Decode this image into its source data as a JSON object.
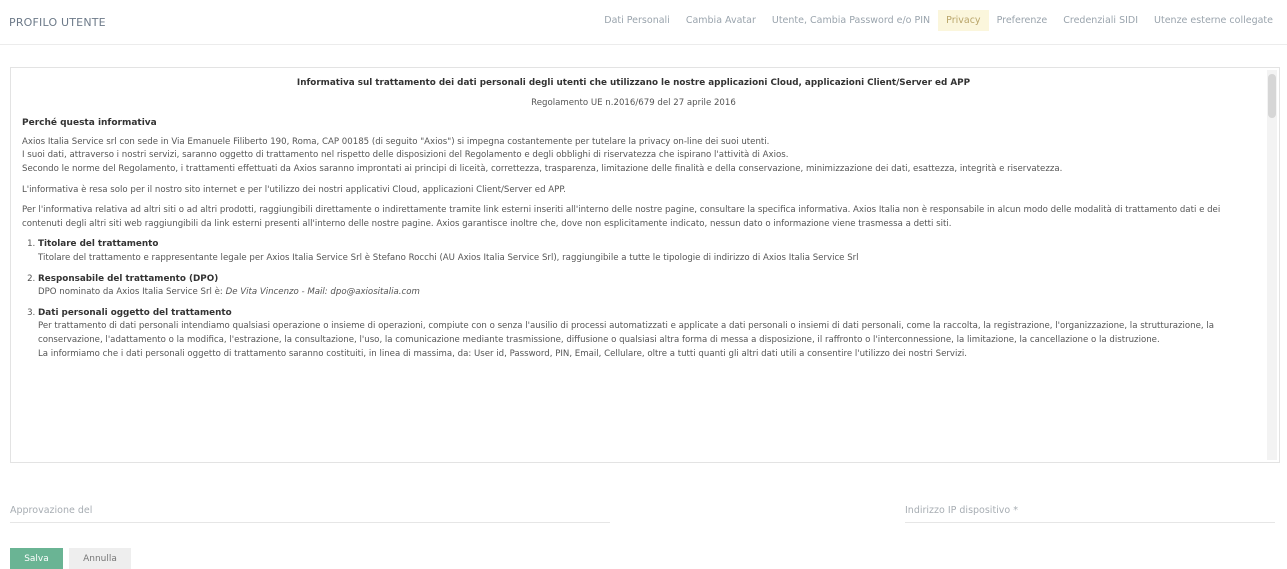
{
  "header": {
    "title": "PROFILO UTENTE",
    "tabs": [
      {
        "label": "Dati Personali",
        "active": false
      },
      {
        "label": "Cambia Avatar",
        "active": false
      },
      {
        "label": "Utente, Cambia Password e/o PIN",
        "active": false
      },
      {
        "label": "Privacy",
        "active": true
      },
      {
        "label": "Preferenze",
        "active": false
      },
      {
        "label": "Credenziali SIDI",
        "active": false
      },
      {
        "label": "Utenze esterne collegate",
        "active": false
      }
    ]
  },
  "document": {
    "title": "Informativa sul trattamento dei dati personali degli utenti che utilizzano le nostre applicazioni Cloud, applicazioni Client/Server ed APP",
    "subtitle": "Regolamento UE n.2016/679 del 27 aprile 2016",
    "section_heading": "Perché questa informativa",
    "para1": "Axios Italia Service srl con sede in Via Emanuele Filiberto 190, Roma, CAP 00185 (di seguito \"Axios\") si impegna costantemente per tutelare la privacy on-line dei suoi utenti.",
    "para2": "I suoi dati, attraverso i nostri servizi, saranno oggetto di trattamento nel rispetto delle disposizioni del Regolamento e degli obblighi di riservatezza che ispirano l'attività di Axios.",
    "para3": "Secondo le norme del Regolamento, i trattamenti effettuati da Axios saranno improntati ai principi di liceità, correttezza, trasparenza, limitazione delle finalità e della conservazione, minimizzazione dei dati, esattezza, integrità e riservatezza.",
    "para4": "L'informativa è resa solo per il nostro sito internet e per l'utilizzo dei nostri applicativi Cloud, applicazioni Client/Server ed APP.",
    "para5": "Per l'informativa relativa ad altri siti o ad altri prodotti, raggiungibili direttamente o indirettamente tramite link esterni inseriti all'interno delle nostre pagine, consultare la specifica informativa. Axios Italia non è responsabile in alcun modo delle modalità di trattamento dati e dei contenuti degli altri siti web raggiungibili da link esterni presenti all'interno delle nostre pagine. Axios garantisce inoltre che, dove non esplicitamente indicato, nessun dato o informazione viene trasmessa a detti siti.",
    "items": [
      {
        "title": "Titolare del trattamento",
        "text": "Titolare del trattamento e rappresentante legale per Axios Italia Service Srl è Stefano Rocchi (AU Axios Italia Service Srl), raggiungibile a tutte le tipologie di indirizzo di Axios Italia Service Srl"
      },
      {
        "title": "Responsabile del trattamento (DPO)",
        "text": "DPO nominato da Axios Italia Service Srl è:",
        "contact": "De Vita Vincenzo - Mail: dpo@axiositalia.com"
      },
      {
        "title": "Dati personali oggetto del trattamento",
        "text": "Per trattamento di dati personali intendiamo qualsiasi operazione o insieme di operazioni, compiute con o senza l'ausilio di processi automatizzati e applicate a dati personali o insiemi di dati personali, come la raccolta, la registrazione, l'organizzazione, la strutturazione, la conservazione, l'adattamento o la modifica, l'estrazione, la consultazione, l'uso, la comunicazione mediante trasmissione, diffusione o qualsiasi altra forma di messa a disposizione, il raffronto o l'interconnessione, la limitazione, la cancellazione o la distruzione.",
        "text2": "La informiamo che i dati personali oggetto di trattamento saranno costituiti, in linea di massima, da: User id, Password, PIN, Email, Cellulare, oltre a tutti quanti gli altri dati utili a consentire l'utilizzo dei nostri Servizi."
      }
    ]
  },
  "form": {
    "approval_label": "Approvazione del",
    "ip_label": "Indirizzo IP dispositivo *"
  },
  "buttons": {
    "save": "Salva",
    "cancel": "Annulla"
  }
}
